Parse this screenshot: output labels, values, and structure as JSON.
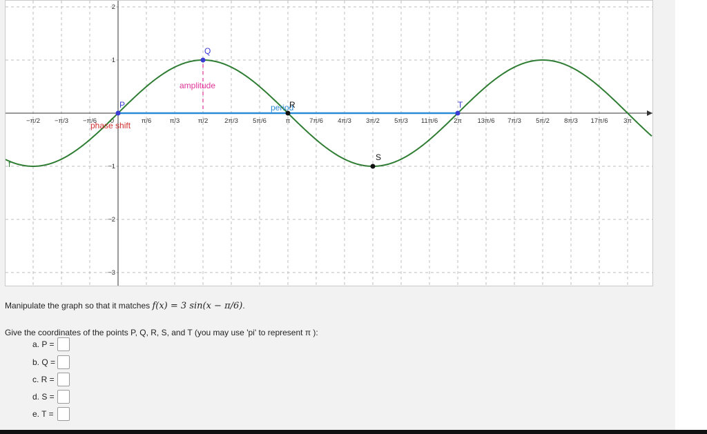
{
  "graph": {
    "x_ticks": [
      "−π/2",
      "−π/3",
      "−π/6",
      "0",
      "π/6",
      "π/3",
      "π/2",
      "2π/3",
      "5π/6",
      "π",
      "7π/6",
      "4π/3",
      "3π/2",
      "5π/3",
      "11π/6",
      "2π",
      "13π/6",
      "7π/3",
      "5π/2",
      "8π/3",
      "17π/6",
      "3π"
    ],
    "y_ticks": [
      "2",
      "1",
      "−1",
      "−2",
      "−3"
    ],
    "function": {
      "amplitude": 1,
      "period": "2π",
      "phase_shift": 0
    },
    "points": [
      {
        "name": "P",
        "x": "0",
        "y": 0
      },
      {
        "name": "Q",
        "x": "π/2",
        "y": 1
      },
      {
        "name": "R",
        "x": "π",
        "y": 0
      },
      {
        "name": "S",
        "x": "3π/2",
        "y": -1
      },
      {
        "name": "T",
        "x": "2π",
        "y": 0
      }
    ],
    "labels": {
      "amplitude": "amplitude",
      "period": "period",
      "phase_shift": "phase shift",
      "curve_name": "f"
    },
    "colors": {
      "curve": "#2e7d32",
      "period_line": "#2a8ad6",
      "amplitude": "#e0339a",
      "phase_shift": "#d32f2f",
      "point_blue": "#3b3bd6",
      "point_black": "#111111"
    }
  },
  "question": {
    "instruction_prefix": "Manipulate the graph so that it matches ",
    "formula": "f(x) = 3 sin(x − π/6)",
    "instruction_suffix": ".",
    "prompt": "Give the coordinates of the points P, Q, R, S, and T (you may use 'pi' to represent π ):",
    "answers": [
      {
        "label": "a. P =",
        "value": ""
      },
      {
        "label": "b. Q =",
        "value": ""
      },
      {
        "label": "c. R =",
        "value": ""
      },
      {
        "label": "d. S =",
        "value": ""
      },
      {
        "label": "e. T =",
        "value": ""
      }
    ]
  }
}
